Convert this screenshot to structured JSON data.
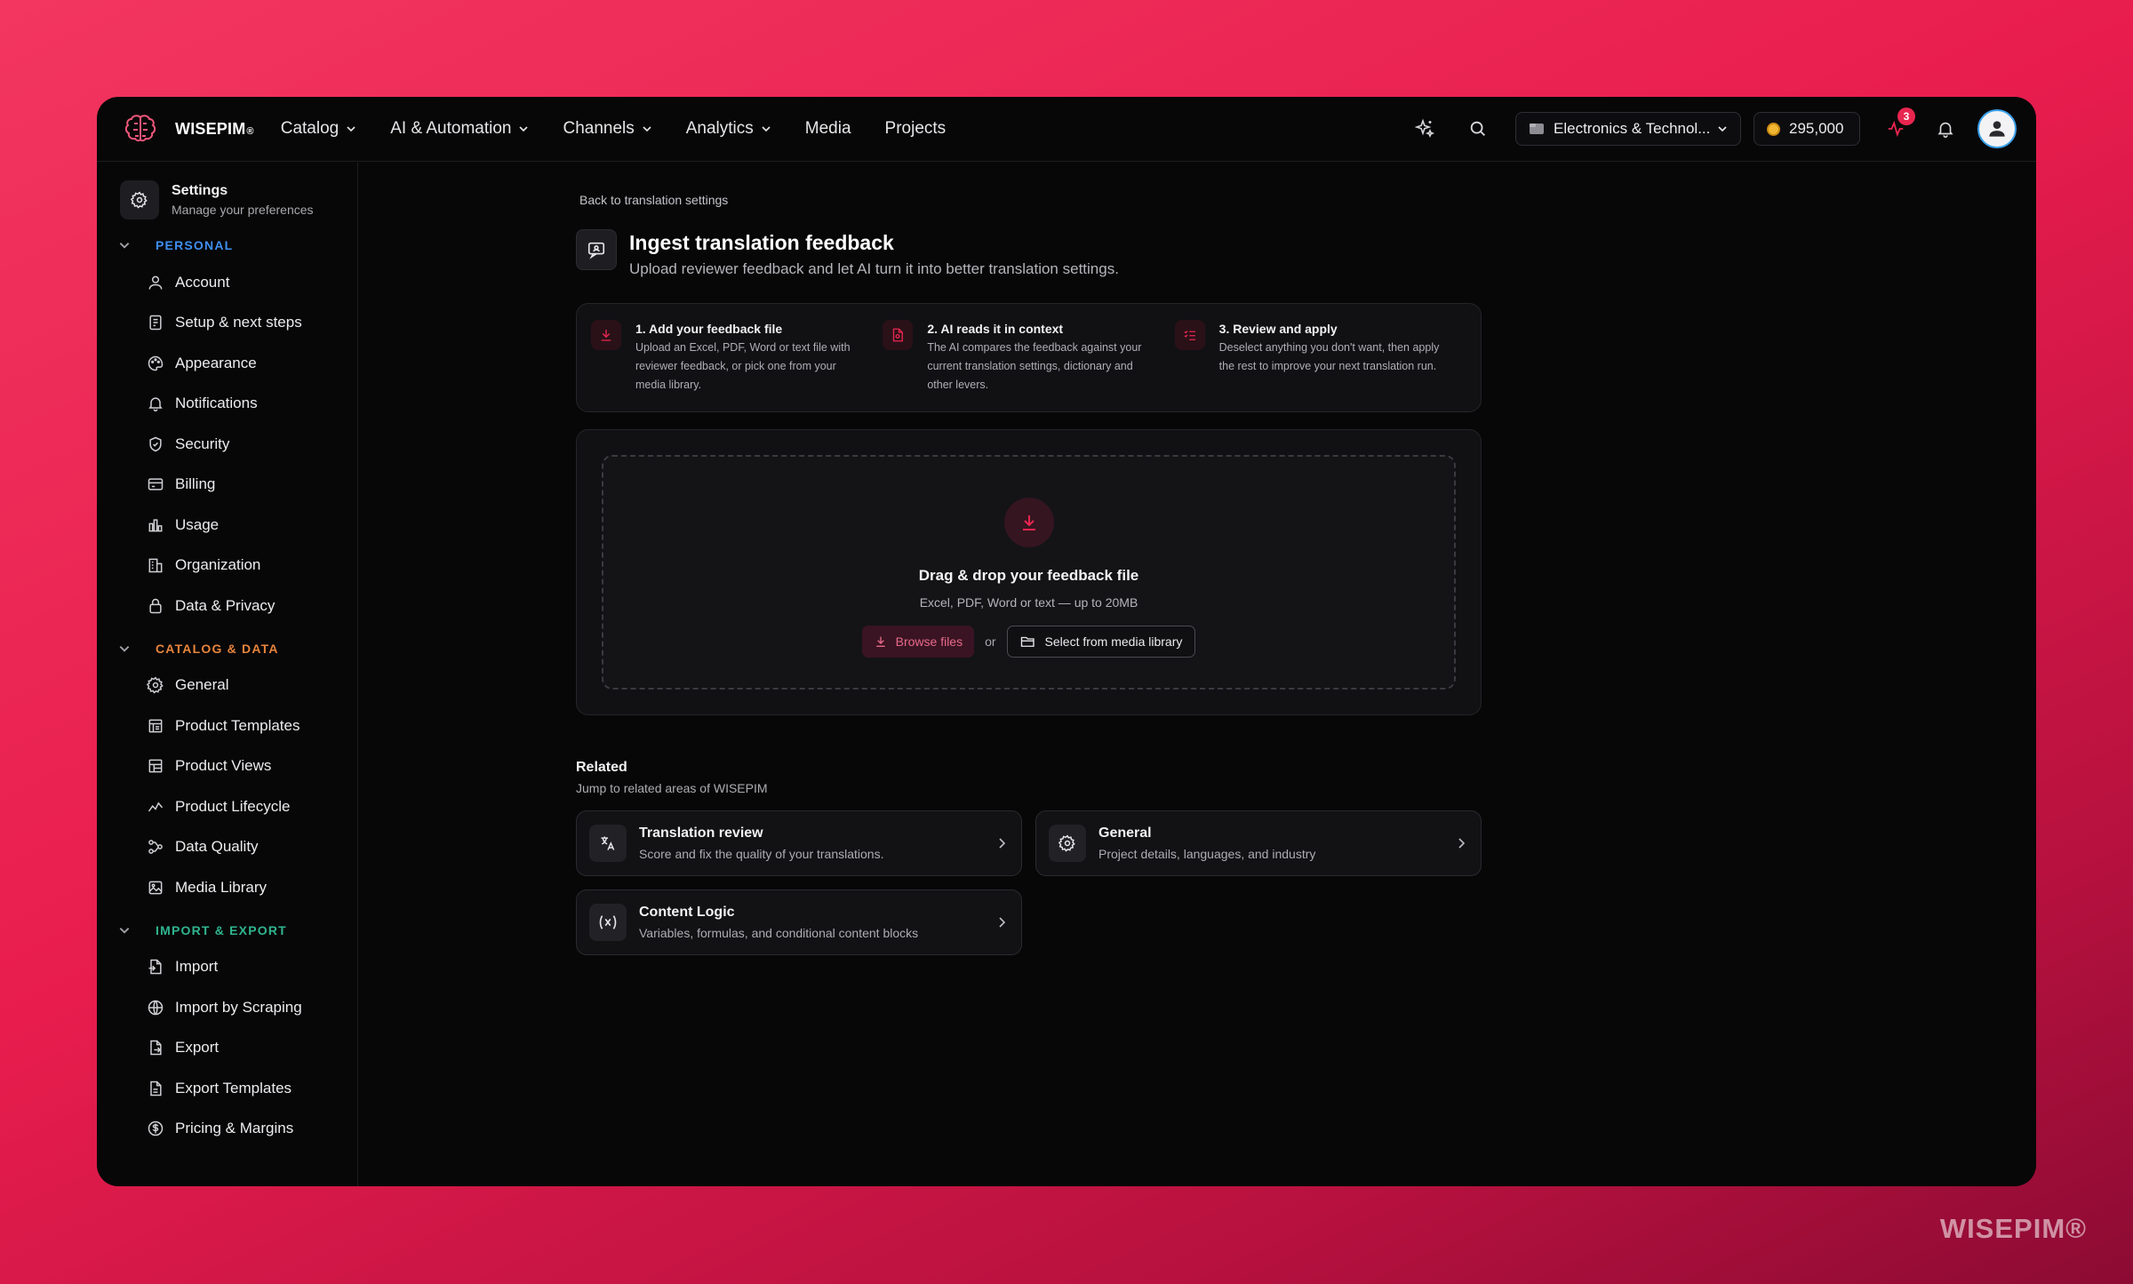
{
  "app": {
    "brand": "WISEPIM",
    "brand_mark": "®",
    "watermark": "WISEPIM®"
  },
  "nav": [
    {
      "label": "Catalog",
      "dropdown": true
    },
    {
      "label": "AI & Automation",
      "dropdown": true
    },
    {
      "label": "Channels",
      "dropdown": true
    },
    {
      "label": "Analytics",
      "dropdown": true
    },
    {
      "label": "Media",
      "dropdown": false
    },
    {
      "label": "Projects",
      "dropdown": false
    }
  ],
  "topright": {
    "project": "Electronics & Technol...",
    "credits": "295,000",
    "notif_count": "3"
  },
  "sidebar": {
    "title": "Settings",
    "subtitle": "Manage your preferences",
    "sections": [
      {
        "label": "PERSONAL",
        "color": "#3f8ff0",
        "items": [
          "Account",
          "Setup & next steps",
          "Appearance",
          "Notifications",
          "Security",
          "Billing",
          "Usage",
          "Organization",
          "Data & Privacy"
        ]
      },
      {
        "label": "CATALOG & DATA",
        "color": "#e8843c",
        "items": [
          "General",
          "Product Templates",
          "Product Views",
          "Product Lifecycle",
          "Data Quality",
          "Media Library"
        ]
      },
      {
        "label": "IMPORT & EXPORT",
        "color": "#2fb58f",
        "items": [
          "Import",
          "Import by Scraping",
          "Export",
          "Export Templates",
          "Pricing & Margins"
        ]
      }
    ]
  },
  "main": {
    "back": "Back to translation settings",
    "title": "Ingest translation feedback",
    "subtitle": "Upload reviewer feedback and let AI turn it into better translation settings.",
    "steps": [
      {
        "title": "1. Add your feedback file",
        "text": "Upload an Excel, PDF, Word or text file with reviewer feedback, or pick one from your media library."
      },
      {
        "title": "2. AI reads it in context",
        "text": "The AI compares the feedback against your current translation settings, dictionary and other levers."
      },
      {
        "title": "3. Review and apply",
        "text": "Deselect anything you don't want, then apply the rest to improve your next translation run."
      }
    ],
    "dropzone": {
      "title": "Drag & drop your feedback file",
      "hint": "Excel, PDF, Word or text — up to 20MB",
      "browse": "Browse files",
      "or": "or",
      "library": "Select from media library"
    },
    "related": {
      "title": "Related",
      "subtitle": "Jump to related areas of WISEPIM",
      "cards": [
        {
          "title": "Translation review",
          "text": "Score and fix the quality of your translations.",
          "icon": "translate-icon"
        },
        {
          "title": "General",
          "text": "Project details, languages, and industry",
          "icon": "gear-icon"
        },
        {
          "title": "Content Logic",
          "text": "Variables, formulas, and conditional content blocks",
          "icon": "variable-icon"
        }
      ]
    }
  }
}
